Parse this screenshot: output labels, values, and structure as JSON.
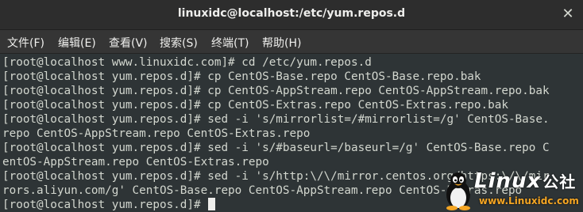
{
  "window": {
    "title": "linuxidc@localhost:/etc/yum.repos.d",
    "close_symbol": "✕"
  },
  "menu": [
    {
      "label": "文件(F)"
    },
    {
      "label": "编辑(E)"
    },
    {
      "label": "查看(V)"
    },
    {
      "label": "搜索(S)"
    },
    {
      "label": "终端(T)"
    },
    {
      "label": "帮助(H)"
    }
  ],
  "terminal": {
    "lines": [
      "[root@localhost www.linuxidc.com]# cd /etc/yum.repos.d",
      "[root@localhost yum.repos.d]# cp CentOS-Base.repo CentOS-Base.repo.bak",
      "[root@localhost yum.repos.d]# cp CentOS-AppStream.repo CentOS-AppStream.repo.bak",
      "[root@localhost yum.repos.d]# cp CentOS-Extras.repo CentOS-Extras.repo.bak",
      "[root@localhost yum.repos.d]# sed -i 's/mirrorlist=/#mirrorlist=/g' CentOS-Base.",
      "repo CentOS-AppStream.repo CentOS-Extras.repo",
      "[root@localhost yum.repos.d]# sed -i 's/#baseurl=/baseurl=/g' CentOS-Base.repo C",
      "entOS-AppStream.repo CentOS-Extras.repo",
      "[root@localhost yum.repos.d]# sed -i 's/http:\\/\\/mirror.centos.org/https:\\/\\/mir",
      "rors.aliyun.com/g' CentOS-Base.repo CentOS-AppStream.repo CentOS-Extras.repo",
      "[root@localhost yum.repos.d]#"
    ]
  },
  "watermark": {
    "brand": "Linux",
    "brand_cn": "公社",
    "url": "www.Linuxidc.com",
    "icon": "tux-penguin-icon"
  },
  "colors": {
    "terminal_bg": "#2e3436",
    "terminal_fg": "#d3d7cf",
    "titlebar_bg": "#2d2d2d",
    "menubar_bg": "#353535",
    "watermark_url": "#f5a623"
  }
}
